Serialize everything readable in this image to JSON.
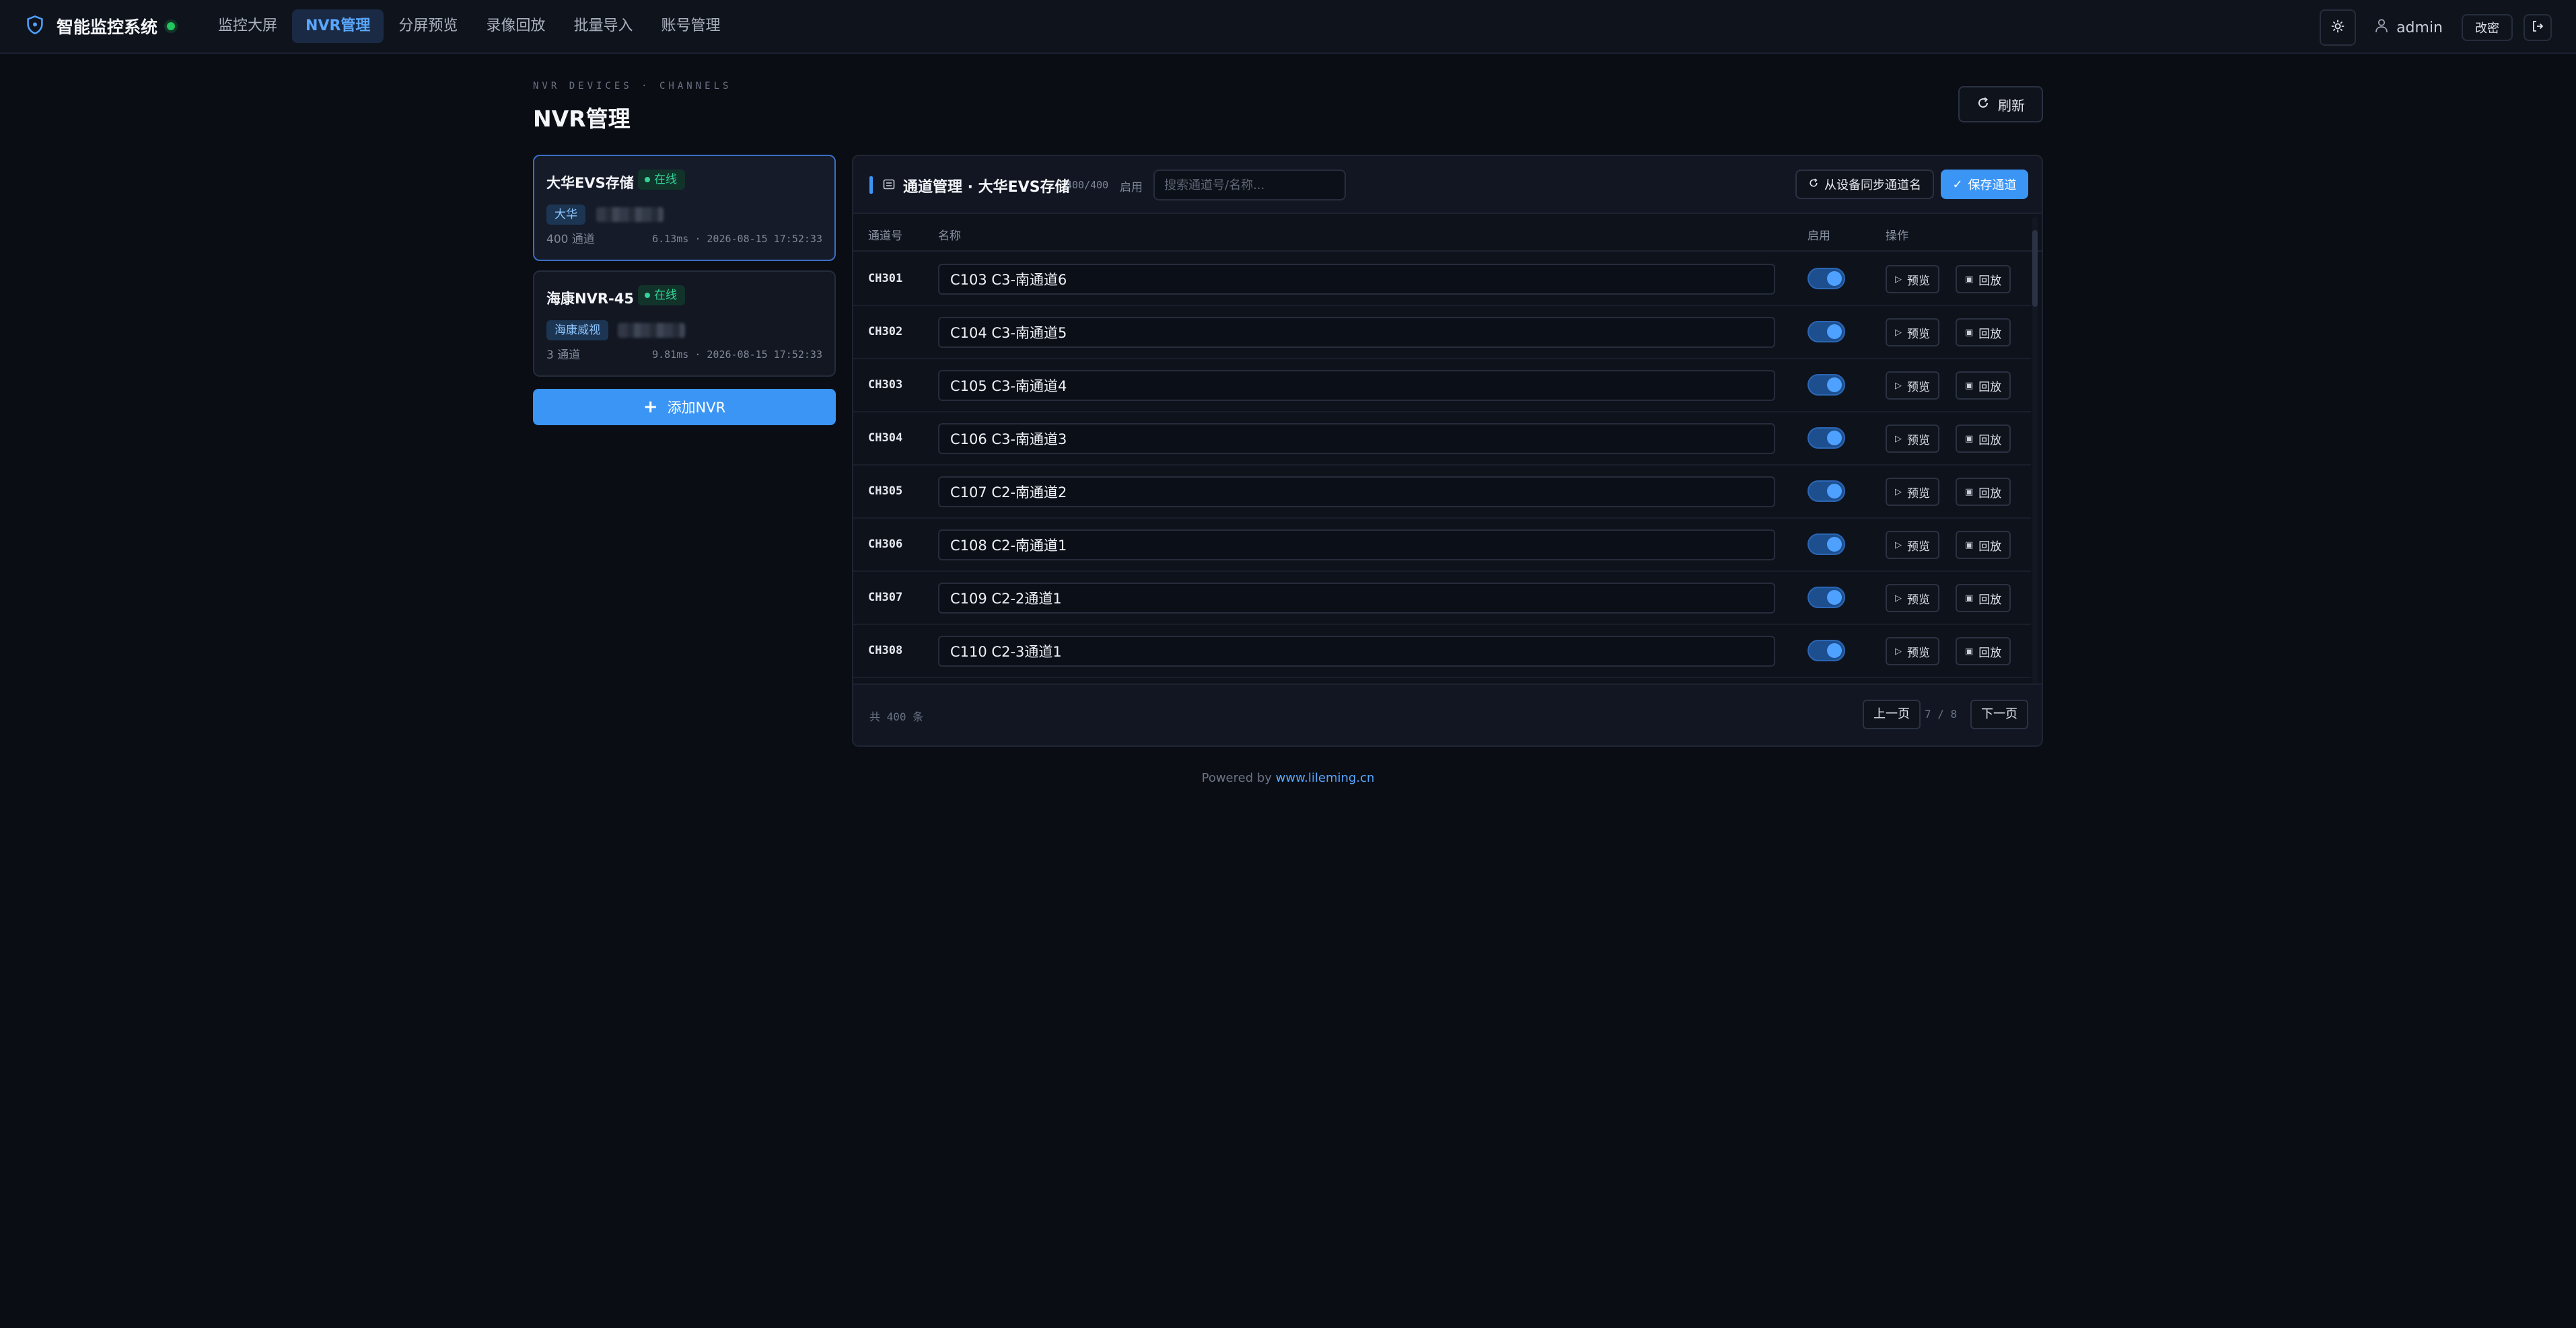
{
  "app": {
    "title": "智能监控系统",
    "nav": [
      "监控大屏",
      "NVR管理",
      "分屏预览",
      "录像回放",
      "批量导入",
      "账号管理"
    ],
    "active_nav": "NVR管理",
    "user": "admin",
    "change_password_label": "改密"
  },
  "page": {
    "subtitle": "NVR DEVICES · CHANNELS",
    "title": "NVR管理",
    "refresh_label": "刷新"
  },
  "devices": [
    {
      "name": "大华EVS存储",
      "status": "在线",
      "brand": "大华",
      "channels": "400 通道",
      "latency": "6.13ms · 2026-08-15 17:52:33"
    },
    {
      "name": "海康NVR-45",
      "status": "在线",
      "brand": "海康威视",
      "channels": "3 通道",
      "latency": "9.81ms · 2026-08-15 17:52:33"
    }
  ],
  "add_nvr_label": "添加NVR",
  "channel_panel": {
    "title": "通道管理 · 大华EVS存储",
    "count": "400/400",
    "enabled_label": "启用",
    "search_placeholder": "搜索通道号/名称...",
    "sync_label": "从设备同步通道名",
    "save_label": "保存通道",
    "columns": {
      "id": "通道号",
      "name": "名称",
      "enabled": "启用",
      "actions": "操作"
    },
    "preview_label": "预览",
    "playback_label": "回放",
    "rows": [
      {
        "id": "CH301",
        "name": "C103 C3-南通道6",
        "enabled": true
      },
      {
        "id": "CH302",
        "name": "C104 C3-南通道5",
        "enabled": true
      },
      {
        "id": "CH303",
        "name": "C105 C3-南通道4",
        "enabled": true
      },
      {
        "id": "CH304",
        "name": "C106 C3-南通道3",
        "enabled": true
      },
      {
        "id": "CH305",
        "name": "C107 C2-南通道2",
        "enabled": true
      },
      {
        "id": "CH306",
        "name": "C108 C2-南通道1",
        "enabled": true
      },
      {
        "id": "CH307",
        "name": "C109 C2-2通道1",
        "enabled": true
      },
      {
        "id": "CH308",
        "name": "C110 C2-3通道1",
        "enabled": true
      }
    ],
    "total": "共 400 条",
    "prev_label": "上一页",
    "page_info": "7 / 8",
    "next_label": "下一页"
  },
  "footer": {
    "prefix": "Powered by",
    "link": "www.lileming.cn"
  },
  "colors": {
    "accent": "#3b95f5",
    "online": "#34d399",
    "background": "#0a0d14"
  }
}
